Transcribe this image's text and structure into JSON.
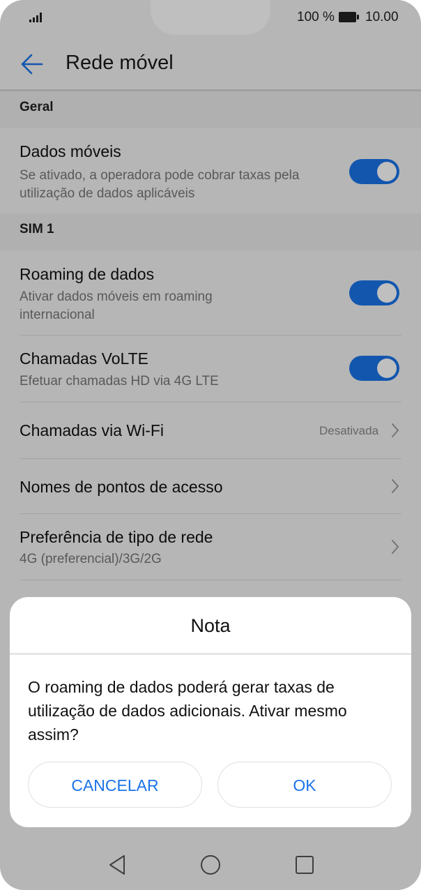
{
  "status_bar": {
    "battery_text": "100 %",
    "time": "10.00",
    "signal_icon": "signal-icon",
    "battery_icon": "battery-icon"
  },
  "app_bar": {
    "title": "Rede móvel",
    "back_icon": "arrow-left-icon"
  },
  "sections": {
    "general": "Geral",
    "sim1": "SIM 1"
  },
  "settings": {
    "mobile_data": {
      "title": "Dados móveis",
      "subtitle": "Se ativado, a operadora pode cobrar taxas pela utilização de dados aplicáveis",
      "enabled": true
    },
    "data_roaming": {
      "title": "Roaming de dados",
      "subtitle": "Ativar dados móveis em roaming internacional",
      "enabled": true
    },
    "volte": {
      "title": "Chamadas VoLTE",
      "subtitle": "Efetuar chamadas HD via 4G LTE",
      "enabled": true
    },
    "wifi_calling": {
      "title": "Chamadas via Wi-Fi",
      "value": "Desativada"
    },
    "apn": {
      "title": "Nomes de pontos de acesso"
    },
    "network_type": {
      "title": "Preferência de tipo de rede",
      "subtitle": "4G (preferencial)/3G/2G"
    }
  },
  "dialog": {
    "title": "Nota",
    "message": "O roaming de dados poderá gerar taxas de utilização de dados adicionais. Ativar mesmo assim?",
    "cancel_label": "CANCELAR",
    "ok_label": "OK"
  },
  "colors": {
    "accent": "#1a73e8",
    "background": "#f3f3f3",
    "section": "#ebebeb",
    "dim_overlay": "rgba(0,0,0,0.25)"
  }
}
